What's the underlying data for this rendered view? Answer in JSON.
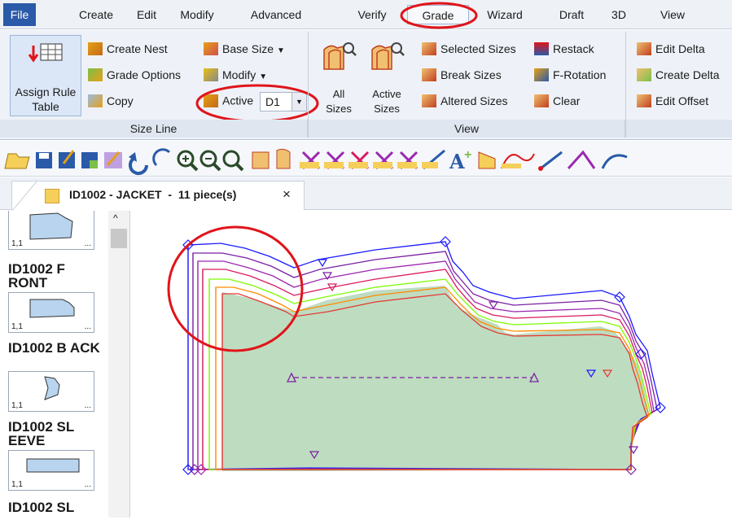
{
  "menu": {
    "items": [
      "File",
      "Create",
      "Edit",
      "Modify",
      "Advanced",
      "Verify",
      "Grade",
      "Wizard",
      "Draft",
      "3D",
      "View"
    ]
  },
  "ribbon": {
    "size_line": {
      "title": "Size Line",
      "assign_rule_table": "Assign Rule Table",
      "create_nest": "Create Nest",
      "grade_options": "Grade Options",
      "copy": "Copy",
      "base_size": "Base Size",
      "modify": "Modify",
      "active_label": "Active",
      "active_value": "D1"
    },
    "view": {
      "title": "View",
      "all_sizes": "All Sizes",
      "active_sizes": "Active Sizes",
      "selected_sizes": "Selected Sizes",
      "break_sizes": "Break Sizes",
      "altered_sizes": "Altered Sizes",
      "restack": "Restack",
      "f_rotation": "F-Rotation",
      "clear": "Clear"
    },
    "delta": {
      "edit_delta": "Edit Delta",
      "create_delta": "Create Delta",
      "edit_offset": "Edit Offset"
    }
  },
  "document_tab": {
    "title": "ID1002 - JACKET  -  11 piece(s)",
    "close": "×"
  },
  "pieces": [
    {
      "tag": "1,1",
      "more": "..."
    },
    {
      "name": "ID1002 F RONT",
      "tag": "1,1",
      "more": "..."
    },
    {
      "name": "ID1002 B ACK",
      "tag": "1,1",
      "more": "..."
    },
    {
      "name": "ID1002 SL EEVE",
      "tag": "1,1",
      "more": "..."
    },
    {
      "name": "ID1002 SL"
    }
  ],
  "colors": {
    "accent": "#2a5aa8",
    "highlight_circle": "#e0141a",
    "piece_fill": "#bedcc0",
    "grade_lines": [
      "#1a1aff",
      "#7b1fa2",
      "#9c27b0",
      "#d81b60",
      "#7cfc00",
      "#ff8c00",
      "#e53935"
    ]
  }
}
